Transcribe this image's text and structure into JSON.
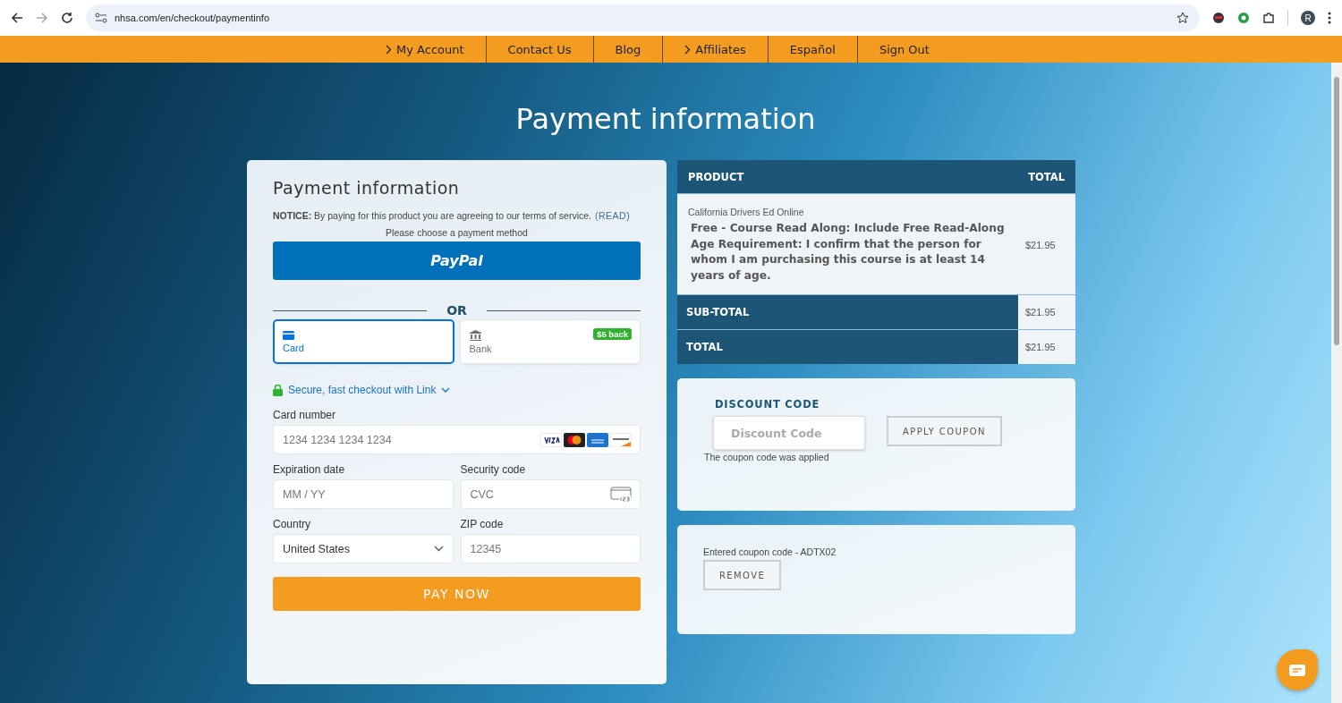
{
  "browser": {
    "url": "nhsa.com/en/checkout/paymentinfo",
    "profile_initial": "R"
  },
  "nav_items": [
    {
      "label": "My Account",
      "submenu": true
    },
    {
      "label": "Contact Us",
      "submenu": false
    },
    {
      "label": "Blog",
      "submenu": false
    },
    {
      "label": "Affiliates",
      "submenu": true
    },
    {
      "label": "Español",
      "submenu": false
    },
    {
      "label": "Sign Out",
      "submenu": false
    }
  ],
  "page_title": "Payment information",
  "payment_form": {
    "title": "Payment information",
    "notice": "**NOTICE:** By paying for this product you are agreeing to our terms of service.",
    "notice_link": "(READ)",
    "choose_text": "Please choose a payment method",
    "paypal_label": "PayPal",
    "divider_text": "OR",
    "methods": [
      {
        "kind": "card",
        "label": "Card",
        "selected": true
      },
      {
        "kind": "bank",
        "label": "Bank",
        "selected": false,
        "badge": "$5 back"
      }
    ],
    "link_text": "Secure, fast checkout with Link",
    "fields": [
      {
        "kind": "card",
        "label": "Card number",
        "placeholder": "1234 1234 1234 1234"
      },
      {
        "kind": "text",
        "label": "Expiration date",
        "placeholder": "MM / YY"
      },
      {
        "kind": "cvc",
        "label": "Security code",
        "placeholder": "CVC"
      },
      {
        "kind": "select",
        "label": "Country",
        "value": "United States"
      },
      {
        "kind": "text",
        "label": "ZIP code",
        "placeholder": "12345"
      }
    ],
    "pay_button": "PAY NOW"
  },
  "order_summary": {
    "columns": [
      "PRODUCT",
      "TOTAL"
    ],
    "product_category": "California Drivers Ed Online",
    "product_details": "Free - Course Read Along: Include Free Read-Along Age Requirement: I confirm that the person for whom I am purchasing this course is at least 14 years of age.",
    "product_total": "$21.95",
    "totals": [
      {
        "label": "SUB-TOTAL",
        "value": "$21.95"
      },
      {
        "label": "TOTAL",
        "value": "$21.95"
      }
    ]
  },
  "discount": {
    "heading": "DISCOUNT CODE",
    "placeholder": "Discount Code",
    "apply_button": "APPLY COUPON",
    "message": "The coupon code was applied"
  },
  "entered_coupon": {
    "text": "Entered coupon code - ADTX02",
    "remove_button": "REMOVE"
  }
}
